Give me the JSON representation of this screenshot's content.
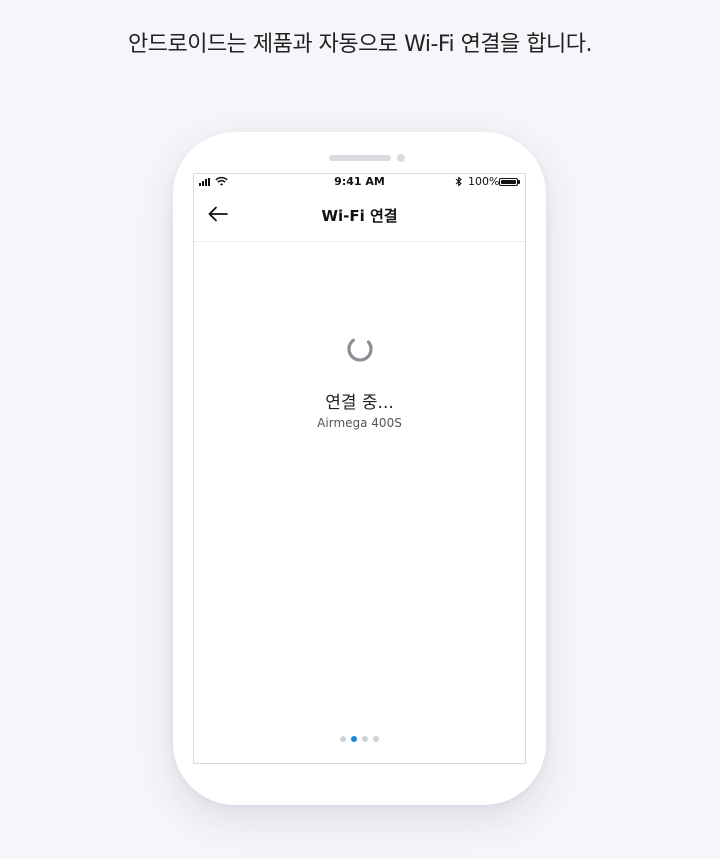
{
  "caption": "안드로이드는 제품과 자동으로 Wi-Fi 연결을 합니다.",
  "status_bar": {
    "time": "9:41 AM",
    "battery": "100%",
    "icons": [
      "signal-icon",
      "wifi-icon",
      "bluetooth-icon",
      "battery-icon"
    ]
  },
  "app_bar": {
    "back_icon": "back-arrow-icon",
    "title": "Wi-Fi 연결"
  },
  "content": {
    "spinner_icon": "loading-spinner-icon",
    "status_title": "연결 중...",
    "device_name": "Airmega 400S"
  },
  "pager": {
    "total": 4,
    "active_index": 1
  },
  "colors": {
    "background": "#f5f6f9",
    "accent": "#1a8ad6",
    "inactive_dot": "#cfd2d8"
  }
}
